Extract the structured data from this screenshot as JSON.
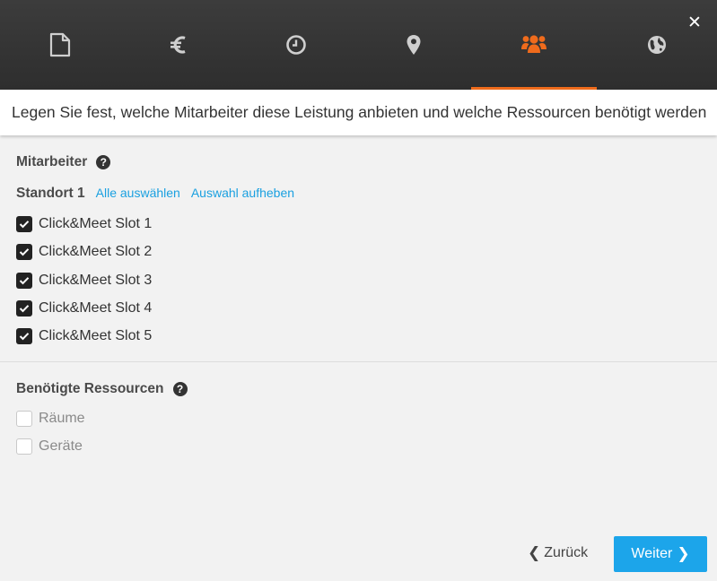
{
  "header": {
    "close_symbol": "✕",
    "tabs": [
      {
        "icon": "document-icon",
        "active": false
      },
      {
        "icon": "euro-icon",
        "active": false
      },
      {
        "icon": "clock-icon",
        "active": false
      },
      {
        "icon": "map-marker-icon",
        "active": false
      },
      {
        "icon": "users-icon",
        "active": true
      },
      {
        "icon": "globe-icon",
        "active": false
      }
    ],
    "tab_color": "#cfcfcf",
    "active_color": "#ef6b1c"
  },
  "subtitle": "Legen Sie fest, welche Mitarbeiter diese Leistung anbieten und welche Ressourcen benötigt werden",
  "employees": {
    "title": "Mitarbeiter",
    "help": "?",
    "location": {
      "label": "Standort 1",
      "select_all": "Alle auswählen",
      "deselect_all": "Auswahl aufheben"
    },
    "items": [
      {
        "label": "Click&Meet Slot 1",
        "checked": true
      },
      {
        "label": "Click&Meet Slot 2",
        "checked": true
      },
      {
        "label": "Click&Meet Slot 3",
        "checked": true
      },
      {
        "label": "Click&Meet Slot 4",
        "checked": true
      },
      {
        "label": "Click&Meet Slot 5",
        "checked": true
      }
    ]
  },
  "resources": {
    "title": "Benötigte Ressourcen",
    "help": "?",
    "items": [
      {
        "label": "Räume",
        "checked": false
      },
      {
        "label": "Geräte",
        "checked": false
      }
    ]
  },
  "footer": {
    "back_label": "Zurück",
    "next_label": "Weiter",
    "chevron_left": "❮",
    "chevron_right": "❯"
  }
}
